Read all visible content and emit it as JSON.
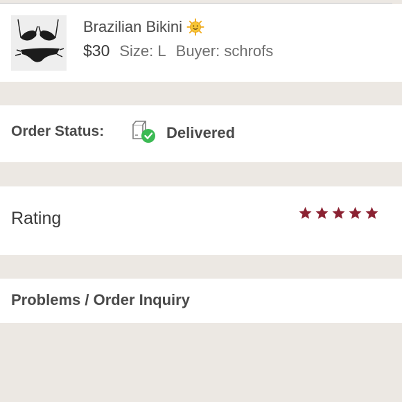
{
  "listing": {
    "title": "Brazilian Bikini",
    "title_emoji_icon": "sun-face-icon",
    "price": "$30",
    "size": "Size: L",
    "buyer": "Buyer: schrofs"
  },
  "order_status": {
    "label": "Order Status:",
    "icon": "delivered-box-icon",
    "value": "Delivered",
    "check_color": "#3cba54"
  },
  "rating": {
    "label": "Rating",
    "stars_filled": 5,
    "stars_total": 5,
    "star_color": "#8b2232"
  },
  "problems": {
    "label": "Problems / Order Inquiry"
  }
}
